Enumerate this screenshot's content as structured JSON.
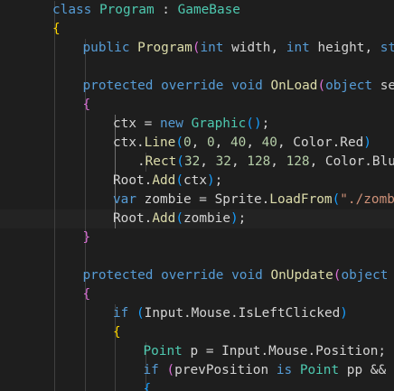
{
  "theme": {
    "background": "#1e1e1e",
    "keyword": "#569cd6",
    "type": "#4ec9b0",
    "function": "#dcdcaa",
    "plain": "#d4d4d4",
    "number": "#b5cea8",
    "string": "#ce9178",
    "bracket_1": "#ffd700",
    "bracket_2": "#da70d6",
    "bracket_3": "#179fff",
    "indent_guide": "#404040",
    "indent_guide_active": "#707070"
  },
  "code_lines": [
    {
      "indent": 1,
      "guides": [
        1
      ],
      "tokens": [
        {
          "t": "class ",
          "c": "kw"
        },
        {
          "t": "Program",
          "c": "ty"
        },
        {
          "t": " : ",
          "c": "pl"
        },
        {
          "t": "GameBase",
          "c": "ty"
        }
      ]
    },
    {
      "indent": 1,
      "guides": [
        1
      ],
      "tokens": [
        {
          "t": "{",
          "c": "p1"
        }
      ]
    },
    {
      "indent": 2,
      "guides": [
        1,
        2
      ],
      "tokens": [
        {
          "t": "public ",
          "c": "kw"
        },
        {
          "t": "Program",
          "c": "fn"
        },
        {
          "t": "(",
          "c": "p2"
        },
        {
          "t": "int",
          "c": "kw"
        },
        {
          "t": " width, ",
          "c": "pl"
        },
        {
          "t": "int",
          "c": "kw"
        },
        {
          "t": " height, ",
          "c": "pl"
        },
        {
          "t": "str",
          "c": "kw"
        }
      ]
    },
    {
      "indent": 0,
      "guides": [
        1,
        2
      ],
      "tokens": []
    },
    {
      "indent": 2,
      "guides": [
        1,
        2
      ],
      "tokens": [
        {
          "t": "protected ",
          "c": "kw"
        },
        {
          "t": "override ",
          "c": "kw"
        },
        {
          "t": "void ",
          "c": "kw"
        },
        {
          "t": "OnLoad",
          "c": "fn"
        },
        {
          "t": "(",
          "c": "p2"
        },
        {
          "t": "object",
          "c": "kw"
        },
        {
          "t": " sen",
          "c": "pl"
        }
      ]
    },
    {
      "indent": 2,
      "guides": [
        1,
        2
      ],
      "tokens": [
        {
          "t": "{",
          "c": "p2"
        }
      ]
    },
    {
      "indent": 3,
      "guides": [
        1,
        2,
        3
      ],
      "tokens": [
        {
          "t": "ctx = ",
          "c": "pl"
        },
        {
          "t": "new ",
          "c": "kw"
        },
        {
          "t": "Graphic",
          "c": "ty"
        },
        {
          "t": "()",
          "c": "p3"
        },
        {
          "t": ";",
          "c": "pl"
        }
      ]
    },
    {
      "indent": 3,
      "guides": [
        1,
        2,
        3
      ],
      "tokens": [
        {
          "t": "ctx.",
          "c": "pl"
        },
        {
          "t": "Line",
          "c": "fn"
        },
        {
          "t": "(",
          "c": "p3"
        },
        {
          "t": "0",
          "c": "nm"
        },
        {
          "t": ", ",
          "c": "pl"
        },
        {
          "t": "0",
          "c": "nm"
        },
        {
          "t": ", ",
          "c": "pl"
        },
        {
          "t": "40",
          "c": "nm"
        },
        {
          "t": ", ",
          "c": "pl"
        },
        {
          "t": "40",
          "c": "nm"
        },
        {
          "t": ", Color.",
          "c": "pl"
        },
        {
          "t": "Red",
          "c": "pl"
        },
        {
          "t": ")",
          "c": "p3"
        }
      ]
    },
    {
      "indent": 3,
      "extra": 2,
      "guides": [
        1,
        2,
        3,
        4
      ],
      "tokens": [
        {
          "t": ".",
          "c": "pl"
        },
        {
          "t": "Rect",
          "c": "fn"
        },
        {
          "t": "(",
          "c": "p3"
        },
        {
          "t": "32",
          "c": "nm"
        },
        {
          "t": ", ",
          "c": "pl"
        },
        {
          "t": "32",
          "c": "nm"
        },
        {
          "t": ", ",
          "c": "pl"
        },
        {
          "t": "128",
          "c": "nm"
        },
        {
          "t": ", ",
          "c": "pl"
        },
        {
          "t": "128",
          "c": "nm"
        },
        {
          "t": ", Color.Blue",
          "c": "pl"
        }
      ]
    },
    {
      "indent": 3,
      "guides": [
        1,
        2,
        3
      ],
      "tokens": [
        {
          "t": "Root.",
          "c": "pl"
        },
        {
          "t": "Add",
          "c": "fn"
        },
        {
          "t": "(",
          "c": "p3"
        },
        {
          "t": "ctx",
          "c": "pl"
        },
        {
          "t": ")",
          "c": "p3"
        },
        {
          "t": ";",
          "c": "pl"
        }
      ]
    },
    {
      "indent": 3,
      "guides": [
        1,
        2,
        3
      ],
      "tokens": [
        {
          "t": "var ",
          "c": "kw"
        },
        {
          "t": "zombie = Sprite.",
          "c": "pl"
        },
        {
          "t": "LoadFrom",
          "c": "fn"
        },
        {
          "t": "(",
          "c": "p3"
        },
        {
          "t": "\"./zombi",
          "c": "st"
        }
      ]
    },
    {
      "indent": 3,
      "guides": [
        1,
        2,
        3
      ],
      "current": true,
      "tokens": [
        {
          "t": "Root.",
          "c": "pl"
        },
        {
          "t": "Add",
          "c": "fn"
        },
        {
          "t": "(",
          "c": "p3"
        },
        {
          "t": "zombie",
          "c": "pl"
        },
        {
          "t": ")",
          "c": "p3"
        },
        {
          "t": ";",
          "c": "pl"
        }
      ]
    },
    {
      "indent": 2,
      "guides": [
        1,
        2
      ],
      "tokens": [
        {
          "t": "}",
          "c": "p2"
        }
      ]
    },
    {
      "indent": 0,
      "guides": [
        1,
        2
      ],
      "tokens": []
    },
    {
      "indent": 2,
      "guides": [
        1,
        2
      ],
      "tokens": [
        {
          "t": "protected ",
          "c": "kw"
        },
        {
          "t": "override ",
          "c": "kw"
        },
        {
          "t": "void ",
          "c": "kw"
        },
        {
          "t": "OnUpdate",
          "c": "fn"
        },
        {
          "t": "(",
          "c": "p2"
        },
        {
          "t": "object",
          "c": "kw"
        },
        {
          "t": " s",
          "c": "pl"
        }
      ]
    },
    {
      "indent": 2,
      "guides": [
        1,
        2
      ],
      "tokens": [
        {
          "t": "{",
          "c": "p2"
        }
      ]
    },
    {
      "indent": 3,
      "guides": [
        1,
        2,
        3
      ],
      "tokens": [
        {
          "t": "if ",
          "c": "kw"
        },
        {
          "t": "(",
          "c": "p3"
        },
        {
          "t": "Input.Mouse.IsLeftClicked",
          "c": "pl"
        },
        {
          "t": ")",
          "c": "p3"
        }
      ]
    },
    {
      "indent": 3,
      "guides": [
        1,
        2,
        3
      ],
      "tokens": [
        {
          "t": "{",
          "c": "p1"
        }
      ]
    },
    {
      "indent": 4,
      "guides": [
        1,
        2,
        3,
        4
      ],
      "tokens": [
        {
          "t": "Point",
          "c": "ty"
        },
        {
          "t": " p = Input.Mouse.Position;",
          "c": "pl"
        }
      ]
    },
    {
      "indent": 4,
      "guides": [
        1,
        2,
        3,
        4
      ],
      "tokens": [
        {
          "t": "if ",
          "c": "kw"
        },
        {
          "t": "(",
          "c": "p2"
        },
        {
          "t": "prevPosition ",
          "c": "pl"
        },
        {
          "t": "is ",
          "c": "kw"
        },
        {
          "t": "Point",
          "c": "ty"
        },
        {
          "t": " pp && p",
          "c": "pl"
        }
      ]
    },
    {
      "indent": 4,
      "guides": [
        1,
        2,
        3,
        4
      ],
      "tokens": [
        {
          "t": "{",
          "c": "p3"
        }
      ]
    }
  ]
}
